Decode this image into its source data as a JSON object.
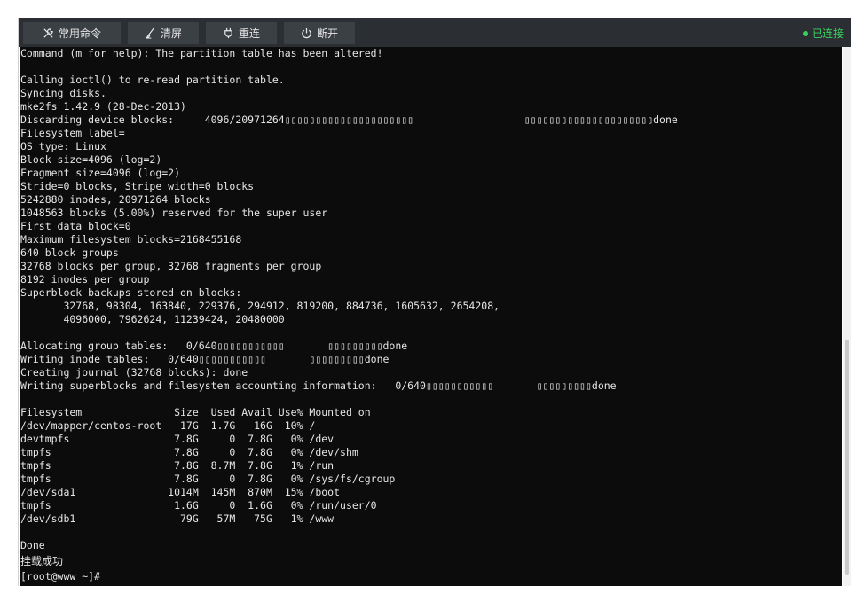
{
  "toolbar": {
    "buttons": [
      {
        "label": "常用命令",
        "icon": "tools-icon"
      },
      {
        "label": "清屏",
        "icon": "brush-icon"
      },
      {
        "label": "重连",
        "icon": "plug-icon"
      },
      {
        "label": "断开",
        "icon": "power-icon"
      }
    ],
    "status": "已连接",
    "status_color": "#3ccf60"
  },
  "terminal": {
    "lines": [
      "Command (m for help): The partition table has been altered!",
      "",
      "Calling ioctl() to re-read partition table.",
      "Syncing disks.",
      "mke2fs 1.42.9 (28-Dec-2013)",
      "Discarding device blocks:     4096/20971264▯▯▯▯▯▯▯▯▯▯▯▯▯▯▯▯▯▯▯▯▯                  ▯▯▯▯▯▯▯▯▯▯▯▯▯▯▯▯▯▯▯▯▯done",
      "Filesystem label=",
      "OS type: Linux",
      "Block size=4096 (log=2)",
      "Fragment size=4096 (log=2)",
      "Stride=0 blocks, Stripe width=0 blocks",
      "5242880 inodes, 20971264 blocks",
      "1048563 blocks (5.00%) reserved for the super user",
      "First data block=0",
      "Maximum filesystem blocks=2168455168",
      "640 block groups",
      "32768 blocks per group, 32768 fragments per group",
      "8192 inodes per group",
      "Superblock backups stored on blocks:",
      "       32768, 98304, 163840, 229376, 294912, 819200, 884736, 1605632, 2654208,",
      "       4096000, 7962624, 11239424, 20480000",
      "",
      "Allocating group tables:   0/640▯▯▯▯▯▯▯▯▯▯▯       ▯▯▯▯▯▯▯▯▯done",
      "Writing inode tables:   0/640▯▯▯▯▯▯▯▯▯▯▯       ▯▯▯▯▯▯▯▯▯done",
      "Creating journal (32768 blocks): done",
      "Writing superblocks and filesystem accounting information:   0/640▯▯▯▯▯▯▯▯▯▯▯       ▯▯▯▯▯▯▯▯▯done",
      "",
      "Filesystem               Size  Used Avail Use% Mounted on",
      "/dev/mapper/centos-root   17G  1.7G   16G  10% /",
      "devtmpfs                 7.8G     0  7.8G   0% /dev",
      "tmpfs                    7.8G     0  7.8G   0% /dev/shm",
      "tmpfs                    7.8G  8.7M  7.8G   1% /run",
      "tmpfs                    7.8G     0  7.8G   0% /sys/fs/cgroup",
      "/dev/sda1               1014M  145M  870M  15% /boot",
      "tmpfs                    1.6G     0  1.6G   0% /run/user/0",
      "/dev/sdb1                 79G   57M   75G   1% /www",
      "",
      "Done"
    ],
    "cjk_line": "挂载成功",
    "prompt": "[root@www ~]#"
  }
}
